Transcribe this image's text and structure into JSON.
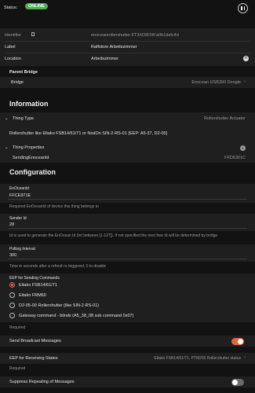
{
  "header": {
    "status_label": "Status:",
    "status_badge": "ONLINE"
  },
  "props": {
    "identifier_label": "Identifier",
    "identifier_value": "enoceanrollershutter:FT3XD8OW:a0b1defc4d",
    "label_label": "Label",
    "label_value": "Raffstore Arbeitszimmer",
    "location_label": "Location",
    "location_value": "Arbeitszimmer"
  },
  "parent_bridge": {
    "heading": "Parent Bridge",
    "bridge_label": "Bridge",
    "bridge_value": "Enocean USB300 Dongle"
  },
  "information": {
    "heading": "Information",
    "thing_type_label": "Thing Type",
    "thing_type_value": "Rollershutter Actuator",
    "description": "Rollershutter like Eltako FSB14/61/71 or NodOn SIN-2-RS-01 (EEP: A5-37, D2-05)",
    "thing_props_label": "Thing Properties",
    "thing_props_count": "1",
    "sending_label": "SendingEnoceanId",
    "sending_value": "FFD6301C"
  },
  "configuration": {
    "heading": "Configuration",
    "enocean_id_label": "EnOceanId",
    "enocean_id_value": "FFCE971E",
    "enocean_id_help": "Required EnOceanId of device this thing belongs to",
    "sender_id_label": "Sender Id",
    "sender_id_value": "28",
    "sender_id_help": "Id is used to generate the EnOcean Id (Int between [1-127]). If not specified the next free Id will be determined by bridge",
    "polling_label": "Polling Interval",
    "polling_value": "300",
    "polling_help": "Time in seconds after a refresh is triggered, 0 to disable",
    "eep_label": "EEP for Sending Commands",
    "eep_options": [
      "Eltako FSB14/61/71",
      "Eltako FRM60",
      "D2-05-00 Rollershutter (like SIN-2-RS-01)",
      "Gateway command - blinds (A5_38_08 sub command 0x07)"
    ],
    "eep_required": "Required",
    "broadcast_label": "Send Broadcast Messages",
    "receiving_label": "EEP for Receiving States",
    "receiving_value": "Eltako FSB14/61/71, PTM200 Rollershutter status",
    "receiving_required": "Required",
    "suppress_label": "Suppress Repeating of Messages"
  },
  "colors": {
    "accent": "#e8623d",
    "online": "#4caf50"
  }
}
